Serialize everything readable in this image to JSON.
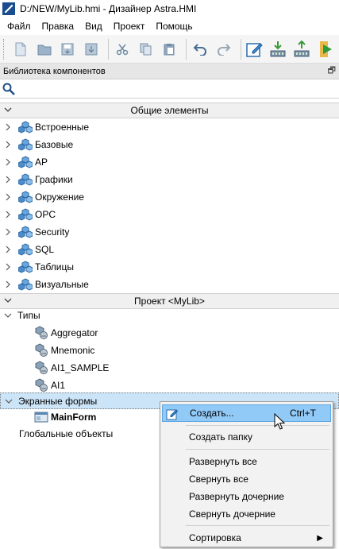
{
  "window": {
    "title": "D:/NEW/MyLib.hmi - Дизайнер Astra.HMI"
  },
  "menubar": {
    "items": [
      "Файл",
      "Правка",
      "Вид",
      "Проект",
      "Помощь"
    ]
  },
  "toolbar": {
    "icons": [
      "new-icon",
      "open-icon",
      "save-icon",
      "save-as-icon",
      "cut-icon",
      "copy-icon",
      "paste-icon",
      "undo-icon",
      "redo-icon",
      "edit-form-icon",
      "download-icon",
      "upload-icon",
      "run-icon"
    ]
  },
  "panel": {
    "title": "Библиотека компонентов",
    "search_placeholder": ""
  },
  "groups": {
    "general": {
      "label": "Общие элементы",
      "items": [
        "Встроенные",
        "Базовые",
        "АР",
        "Графики",
        "Окружение",
        "OPC",
        "Security",
        "SQL",
        "Таблицы",
        "Визуальные"
      ]
    },
    "project": {
      "label": "Проект <MyLib>",
      "types_label": "Типы",
      "types": [
        "Aggregator",
        "Mnemonic",
        "AI1_SAMPLE",
        "AI1"
      ],
      "forms_label": "Экранные формы",
      "forms": [
        "MainForm"
      ],
      "globals_label": "Глобальные объекты"
    }
  },
  "context_menu": {
    "create": "Создать...",
    "create_shortcut": "Ctrl+T",
    "create_folder": "Создать папку",
    "expand_all": "Развернуть все",
    "collapse_all": "Свернуть все",
    "expand_children": "Развернуть дочерние",
    "collapse_children": "Свернуть дочерние",
    "sort": "Сортировка"
  },
  "colors": {
    "selection": "#cce4f7",
    "menu_highlight": "#91c9f7",
    "component_icon": "#3b7fc4"
  }
}
